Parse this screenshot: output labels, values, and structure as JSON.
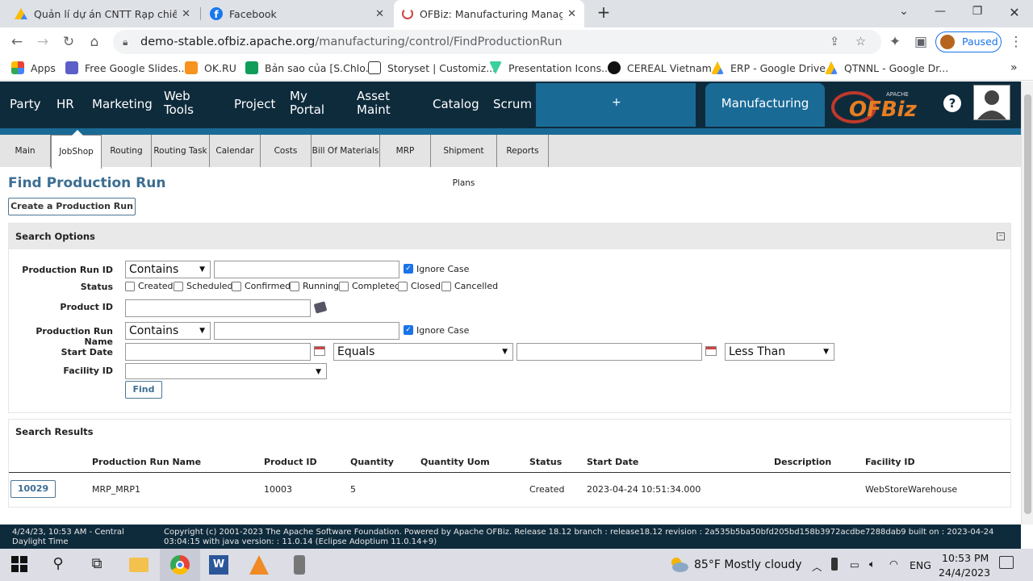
{
  "browser": {
    "tabs": [
      {
        "title": "Quản lí dự án CNTT Rạp chiếu CGV",
        "icon": "google-drive-icon"
      },
      {
        "title": "Facebook",
        "icon": "facebook-icon"
      },
      {
        "title": "OFBiz: Manufacturing Manager: Find Production Run",
        "icon": "ofbiz-icon"
      }
    ],
    "url_host": "demo-stable.ofbiz.apache.org",
    "url_path": "/manufacturing/control/FindProductionRun",
    "profile_label": "Paused",
    "bookmarks": [
      "Apps",
      "Free Google Slides...",
      "OK.RU",
      "Bản sao của [S.Chlo...",
      "Storyset | Customiz...",
      "Presentation Icons...",
      "CEREAL Vietnam",
      "ERP - Google Drive",
      "QTNNL - Google Dr..."
    ]
  },
  "app": {
    "nav": [
      "Party",
      "HR",
      "Marketing",
      "Web Tools",
      "Project",
      "My Portal",
      "Asset Maint",
      "Catalog",
      "Scrum"
    ],
    "plus": "+",
    "active_app": "Manufacturing",
    "logo_text": "OFBiz",
    "logo_small": "APACHE",
    "help": "?",
    "subnav": [
      "Main",
      "JobShop",
      "Routing",
      "Routing Task",
      "Calendar",
      "Costs",
      "Bill Of Materials",
      "MRP",
      "Shipment Plans",
      "Reports"
    ],
    "selected_subnav": "JobShop"
  },
  "page": {
    "title": "Find Production Run",
    "create_button": "Create a Production Run",
    "search_options": {
      "header": "Search Options",
      "labels": {
        "run_id": "Production Run ID",
        "status": "Status",
        "product_id": "Product ID",
        "run_name": "Production Run Name",
        "start_date": "Start Date",
        "facility_id": "Facility ID"
      },
      "contains": "Contains",
      "ignore_case": "Ignore Case",
      "statuses": [
        "Created",
        "Scheduled",
        "Confirmed",
        "Running",
        "Completed",
        "Closed",
        "Cancelled"
      ],
      "equals": "Equals",
      "less_than": "Less Than",
      "find_button": "Find"
    },
    "results": {
      "header": "Search Results",
      "columns": [
        "Production Run Name",
        "Product ID",
        "Quantity",
        "Quantity Uom",
        "Status",
        "Start Date",
        "Description",
        "Facility ID"
      ],
      "rows": [
        {
          "id": "10029",
          "name": "MRP_MRP1",
          "product": "10003",
          "qty": "5",
          "uom": "",
          "status": "Created",
          "start": "2023-04-24 10:51:34.000",
          "desc": "",
          "facility": "WebStoreWarehouse"
        }
      ]
    }
  },
  "footer": {
    "datetime": "4/24/23, 10:53 AM - Central Daylight Time",
    "copyright": "Copyright (c) 2001-2023 The Apache Software Foundation. Powered by Apache OFBiz. Release 18.12 branch : release18.12 revision : 2a535b5ba50bfd205bd158b3972acdbe7288dab9 built on : 2023-04-24 03:04:15 with java version: : 11.0.14 (Eclipse Adoptium 11.0.14+9)"
  },
  "taskbar": {
    "weather": "85°F  Mostly cloudy",
    "lang": "ENG",
    "time": "10:53 PM",
    "date": "24/4/2023"
  }
}
